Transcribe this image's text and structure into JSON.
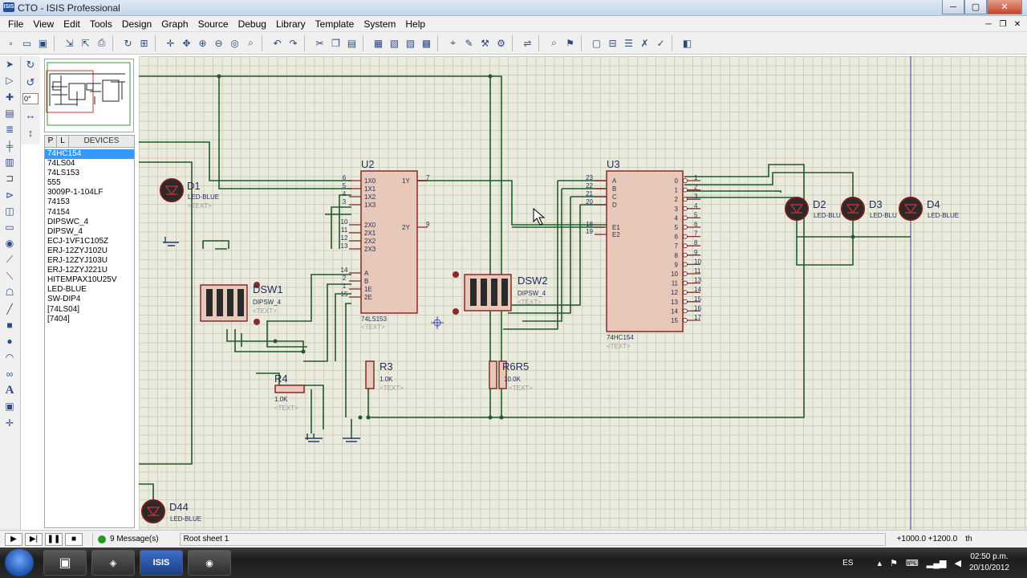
{
  "window": {
    "app_badge": "ISIS",
    "title": "CTO - ISIS Professional",
    "min": "─",
    "max": "▢",
    "close": "✕"
  },
  "menu": [
    "File",
    "View",
    "Edit",
    "Tools",
    "Design",
    "Graph",
    "Source",
    "Debug",
    "Library",
    "Template",
    "System",
    "Help"
  ],
  "toolbar_icons": [
    "new-icon",
    "open-icon",
    "save-icon",
    "sep",
    "import-icon",
    "export-icon",
    "print-icon",
    "sep",
    "refresh-icon",
    "grid-icon",
    "sep",
    "origin-icon",
    "pan-icon",
    "zoom-in-icon",
    "zoom-out-icon",
    "zoom-all-icon",
    "zoom-area-icon",
    "sep",
    "undo-icon",
    "redo-icon",
    "sep",
    "cut-icon",
    "copy-icon",
    "paste-icon",
    "sep",
    "block-copy-icon",
    "block-move-icon",
    "block-rotate-icon",
    "block-delete-icon",
    "sep",
    "pick-device-icon",
    "make-device-icon",
    "package-icon",
    "decompose-icon",
    "sep",
    "wire-autorouter-icon",
    "sep",
    "search-icon",
    "property-tool-icon",
    "sep",
    "new-sheet-icon",
    "remove-sheet-icon",
    "bom-icon",
    "netlist-icon",
    "electrical-check-icon",
    "sep",
    "ares-icon"
  ],
  "rotation_field": "0°",
  "devices": {
    "header": "DEVICES",
    "tab_p": "P",
    "tab_l": "L",
    "items": [
      "74HC154",
      "74LS04",
      "74LS153",
      "555",
      "3009P-1-104LF",
      "74153",
      "74154",
      "DIPSWC_4",
      "DIPSW_4",
      "ECJ-1VF1C105Z",
      "ERJ-12ZYJ102U",
      "ERJ-12ZYJ103U",
      "ERJ-12ZYJ221U",
      "HITEMPAX10U25V",
      "LED-BLUE",
      "SW-DIP4",
      "[74LS04]",
      "[7404]"
    ],
    "selected": 0
  },
  "schematic": {
    "labels": {
      "d1": "D1",
      "d1_type": "LED-BLUE",
      "d1_text": "<TEXT>",
      "u2": "U2",
      "u2_part": "74LS153",
      "u2_text": "<TEXT>",
      "u3": "U3",
      "u3_part": "74HC154",
      "u3_text": "<TEXT>",
      "dsw1": "DSW1",
      "dsw1_type": "DIPSW_4",
      "dsw1_text": "<TEXT>",
      "dsw2": "DSW2",
      "dsw2_type": "DIPSW_4",
      "dsw2_text": "<TEXT>",
      "r3": "R3",
      "r3_val": "1.0K",
      "r3_text": "<TEXT>",
      "r4": "R4",
      "r4_val": "1.0K",
      "r4_text": "<TEXT>",
      "r56": "R6R5",
      "r56_val": "10.0K",
      "r56_text": "<TEXT>",
      "d2": "D2",
      "d3": "D3",
      "d4": "D4",
      "led_type": "LED-BLU",
      "d4_type": "LED-BLUE",
      "d44": "D44",
      "d44_type": "LED-BLUE"
    },
    "u2_pins_left": [
      [
        "6",
        "1X0"
      ],
      [
        "5",
        "1X1"
      ],
      [
        "4",
        "1X2"
      ],
      [
        "3",
        "1X3"
      ],
      [
        "10",
        "2X0"
      ],
      [
        "11",
        "2X1"
      ],
      [
        "12",
        "2X2"
      ],
      [
        "13",
        "2X3"
      ],
      [
        "14",
        "A"
      ],
      [
        "2",
        "B"
      ],
      [
        "1",
        "1E"
      ],
      [
        "15",
        "2E"
      ]
    ],
    "u2_pins_right": [
      [
        "7",
        "1Y"
      ],
      [
        "9",
        "2Y"
      ]
    ],
    "u3_pins_left": [
      [
        "23",
        "A"
      ],
      [
        "22",
        "B"
      ],
      [
        "21",
        "C"
      ],
      [
        "20",
        "D"
      ],
      [
        "18",
        "E1"
      ],
      [
        "19",
        "E2"
      ]
    ],
    "u3_outputs": [
      "0",
      "1",
      "2",
      "3",
      "4",
      "5",
      "6",
      "7",
      "8",
      "9",
      "10",
      "11",
      "12",
      "13",
      "14",
      "15"
    ],
    "u3_out_pins": [
      "1",
      "2",
      "3",
      "4",
      "5",
      "6",
      "7",
      "8",
      "9",
      "10",
      "11",
      "13",
      "14",
      "15",
      "16",
      "17"
    ]
  },
  "status": {
    "messages": "9 Message(s)",
    "sheet": "Root sheet 1",
    "coords": "+1000.0  +1200.0",
    "unit": "th"
  },
  "taskbar": {
    "isis_label": "ISIS",
    "lang": "ES",
    "time": "02:50 p.m.",
    "date": "20/10/2012"
  }
}
